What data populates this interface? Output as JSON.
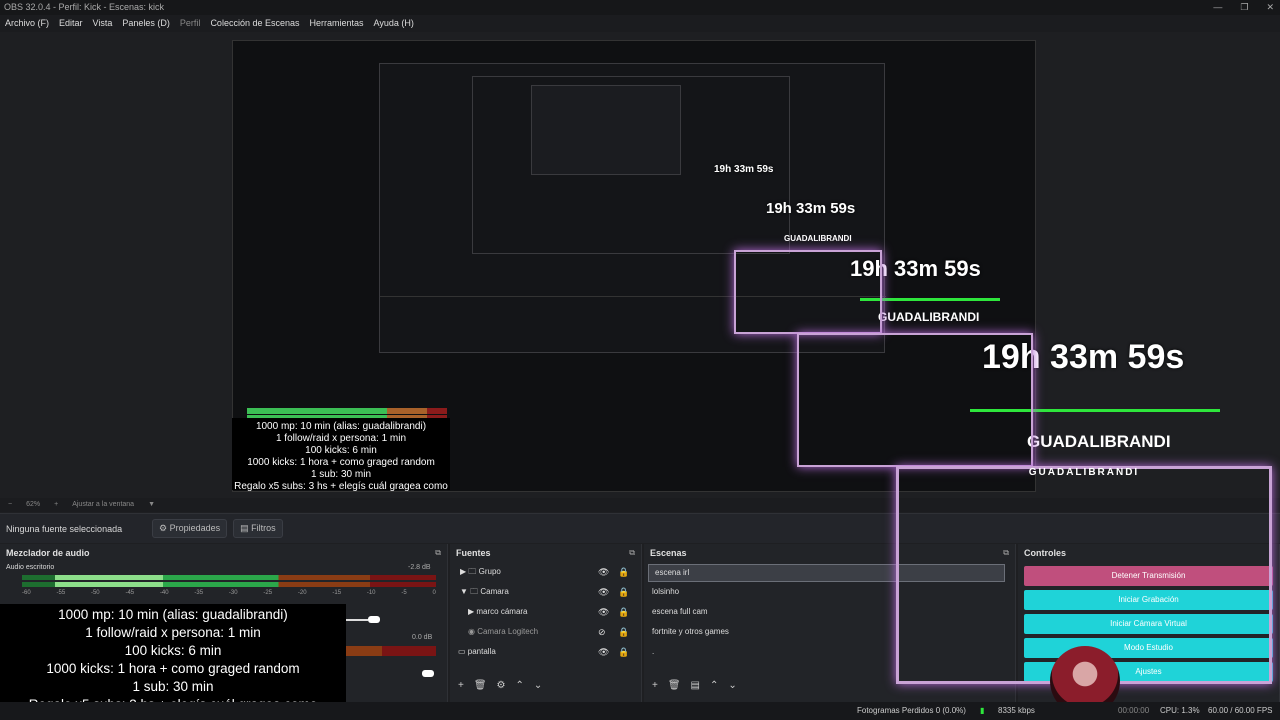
{
  "window": {
    "title": "OBS 32.0.4 - Perfil: Kick - Escenas: kick"
  },
  "menu": [
    "Archivo (F)",
    "Editar",
    "Vista",
    "Paneles (D)",
    "Perfil",
    "Colección de Escenas",
    "Herramientas",
    "Ayuda (H)"
  ],
  "zoom": {
    "level": "62%",
    "fit": "Ajustar a la ventana"
  },
  "source_bar": {
    "none_selected": "Ninguna fuente seleccionada",
    "properties": "Propiedades",
    "filters": "Filtros"
  },
  "mixer": {
    "title": "Mezclador de audio",
    "channel": "Audio escritorio",
    "db1": "-2.8 dB",
    "db2": "0.0 dB",
    "scale": [
      "-60",
      "-55",
      "-50",
      "-45",
      "-40",
      "-35",
      "-30",
      "-25",
      "-20",
      "-15",
      "-10",
      "-5",
      "0"
    ]
  },
  "sources": {
    "title": "Fuentes",
    "items": [
      "Grupo",
      "Camara",
      "marco cámara",
      "Camara Logitech",
      "pantalla"
    ]
  },
  "scenes": {
    "title": "Escenas",
    "items": [
      "escena irl",
      "lolsinho",
      "escena full cam",
      "fortnite y otros games",
      "."
    ]
  },
  "controls": {
    "title": "Controles",
    "buttons": [
      "Detener Transmisión",
      "Iniciar Grabación",
      "Iniciar Cámara Virtual",
      "Modo Estudio",
      "Ajustes"
    ]
  },
  "overlay": {
    "lines": [
      "1000 mp: 10 min (alias: guadalibrandi)",
      "1 follow/raid x persona: 1 min",
      "100 kicks: 6 min",
      "1000 kicks: 1 hora + como graged random",
      "1 sub: 30 min",
      "Regalo x5 subs: 3 hs + elegís cuál gragea como"
    ],
    "timer": "19h 33m 59s",
    "name": "GUADALIBRANDI",
    "frame_label": "GUADALIBRANDI"
  },
  "status": {
    "dropped": "Fotogramas Perdidos 0 (0.0%)",
    "kbps": "8335 kbps",
    "time": "00:00:00",
    "cpu": "CPU: 1.3%",
    "fps": "60.00 / 60.00 FPS"
  },
  "colors": {
    "stop_stream": "#c04f7d",
    "cyan": "#1fd3d8",
    "frame": "#c9a3d6"
  }
}
